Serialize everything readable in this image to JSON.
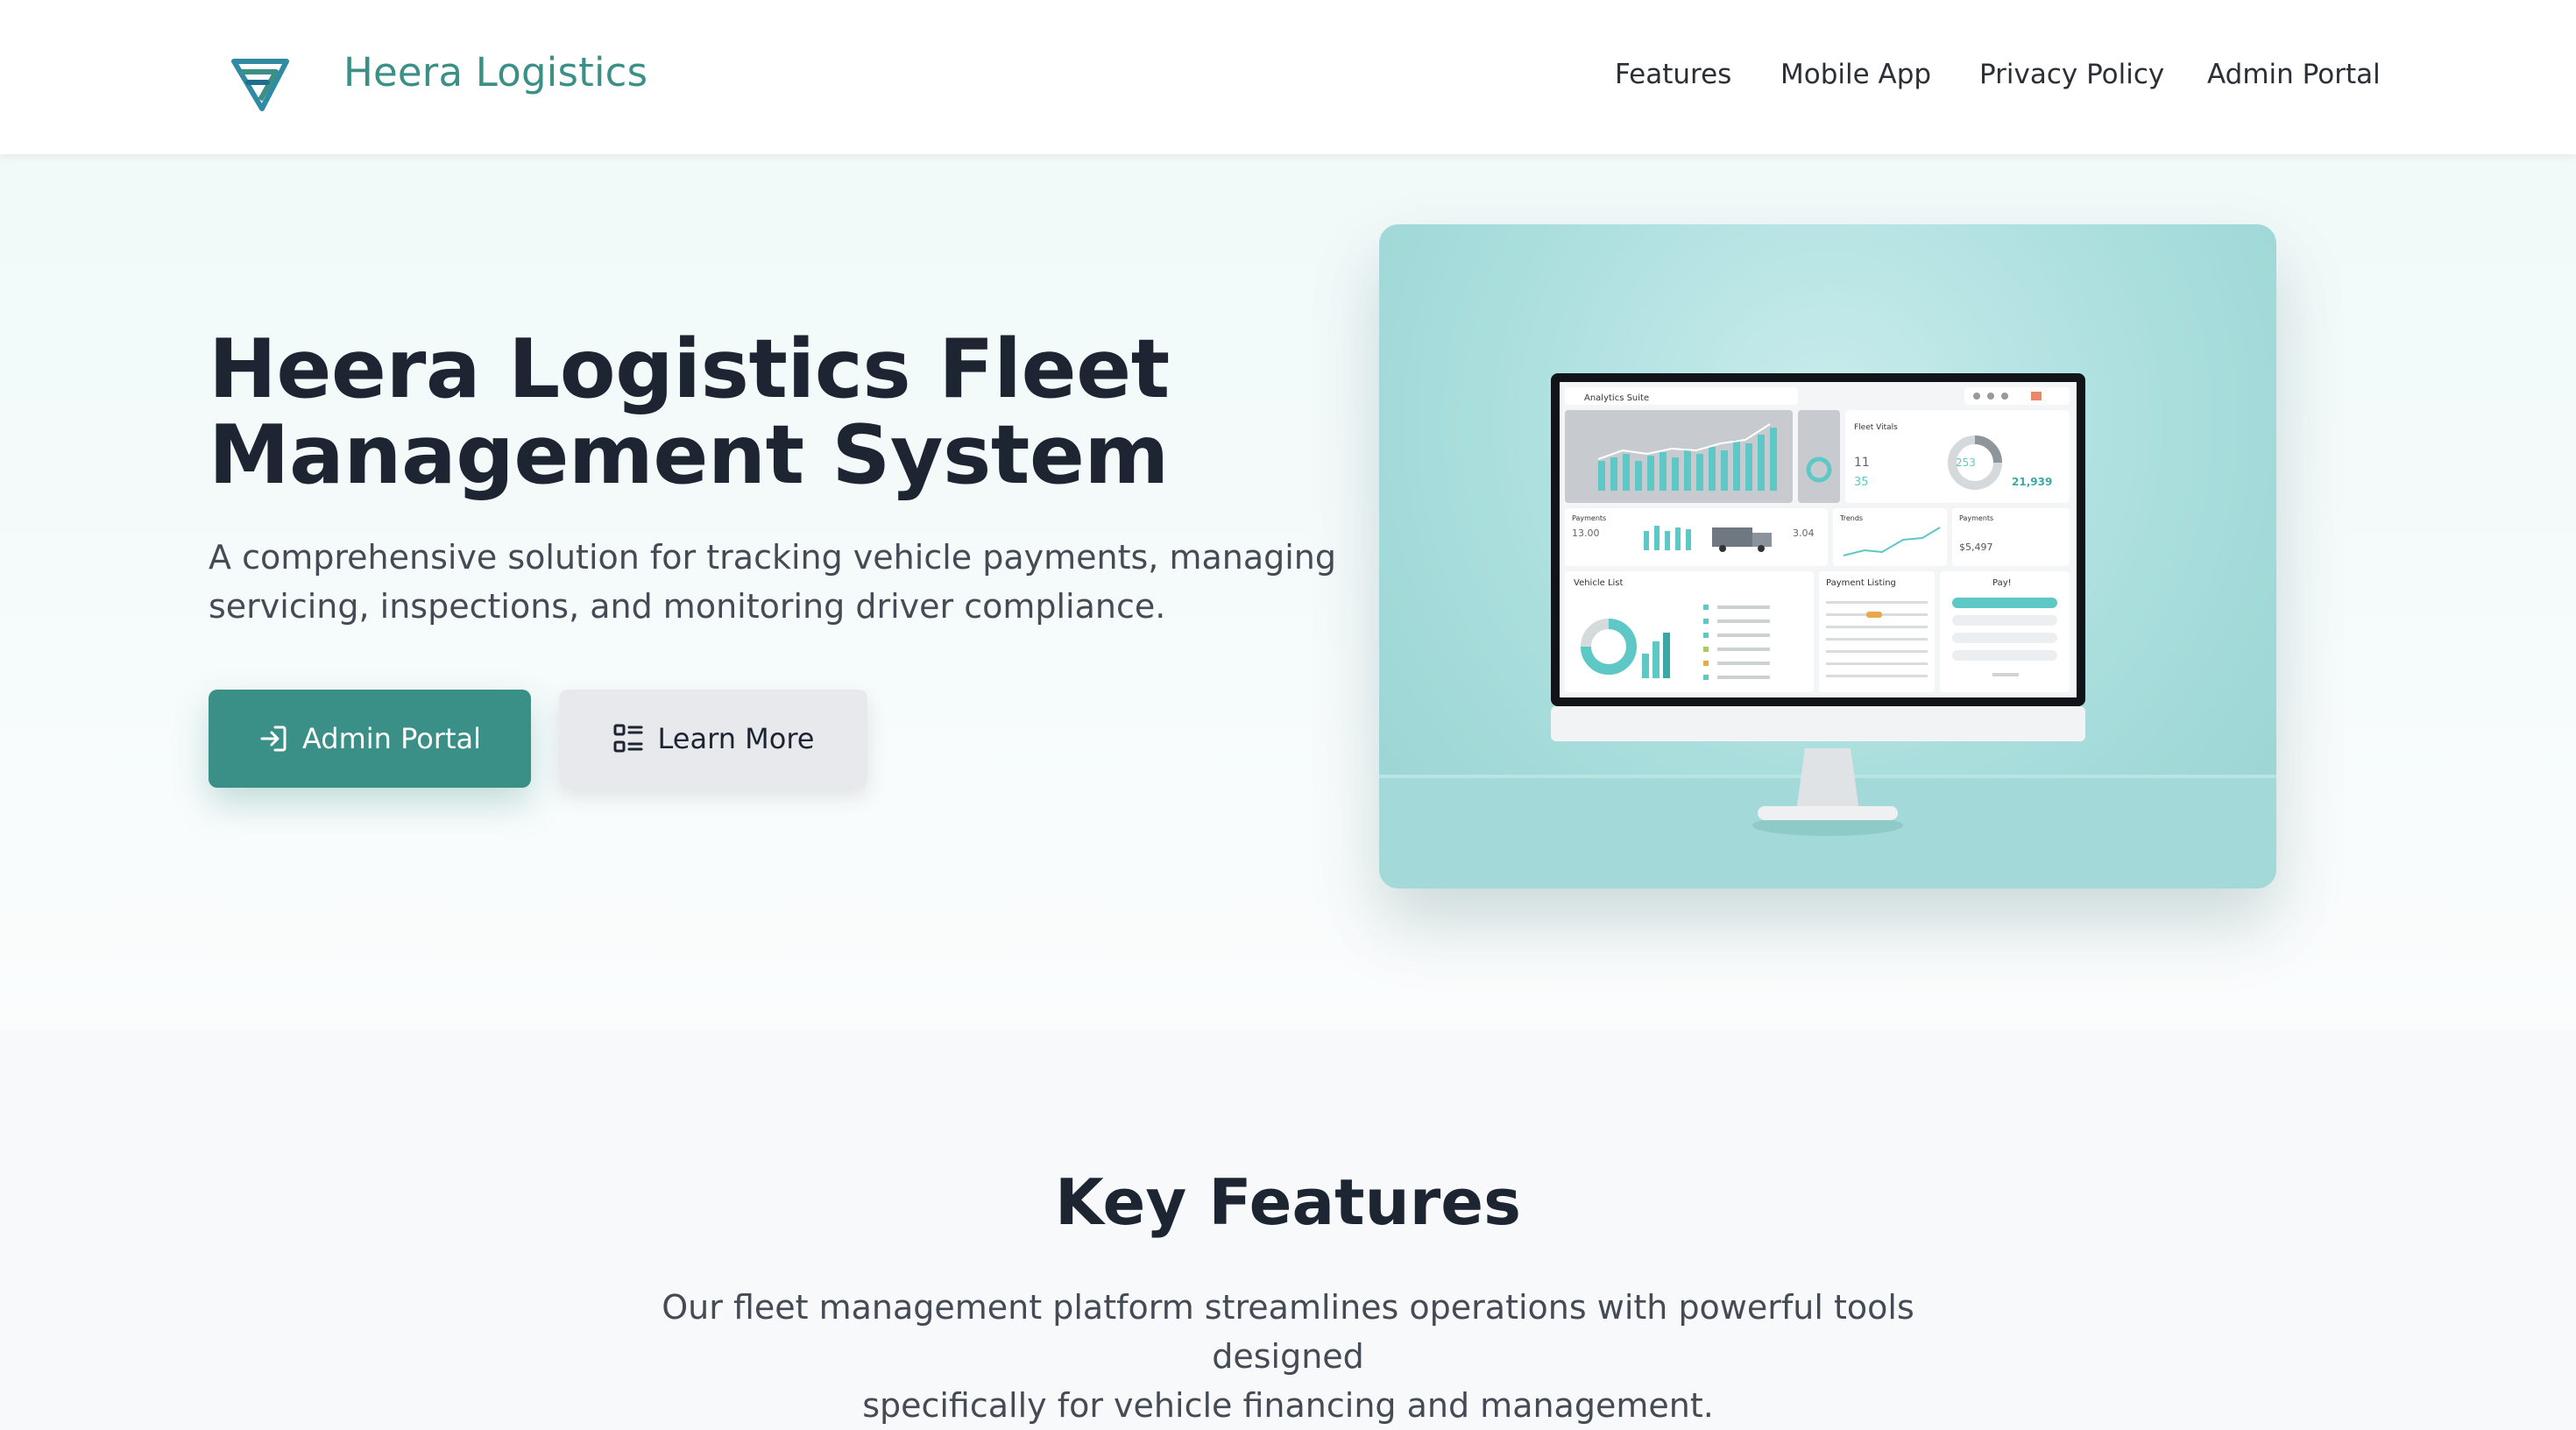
{
  "header": {
    "brand": "Heera Logistics",
    "logo_icon": "chevron-diamond-logo-icon",
    "nav": [
      {
        "label": "Features"
      },
      {
        "label": "Mobile App"
      },
      {
        "label": "Privacy Policy"
      },
      {
        "label": "Admin Portal"
      }
    ]
  },
  "hero": {
    "title_line1": "Heera Logistics Fleet",
    "title_line2": "Management System",
    "subtitle": "A comprehensive solution for tracking vehicle payments, managing servicing, inspections, and monitoring driver compliance.",
    "primary_button": {
      "label": "Admin Portal",
      "icon": "login-icon"
    },
    "secondary_button": {
      "label": "Learn More",
      "icon": "list-icon"
    },
    "image": {
      "description_icon": "dashboard-monitor-illustration",
      "screen_labels": {
        "topbar": "Analytics Suite",
        "card_a": "Fleet Vitals",
        "card_a_v1": "11",
        "card_a_v2": "35",
        "card_a_v3": "21,939",
        "card_a_gauge": "253",
        "row2_a": "Payments",
        "row2_a_v1": "13.00",
        "row2_a_v2": "3.04",
        "row2_b": "Trends",
        "row2_c": "Payments",
        "row2_c_v1": "$5,497",
        "vehicle_list": "Vehicle List",
        "payment_title": "Payment Listing",
        "pay_title": "Pay!"
      }
    }
  },
  "features": {
    "title": "Key Features",
    "subtitle_line1": "Our fleet management platform streamlines operations with powerful tools designed",
    "subtitle_line2": "specifically for vehicle financing and management."
  },
  "colors": {
    "brand": "#3a8f86",
    "text_dark": "#1e2532",
    "text_muted": "#454b55",
    "hero_image_bg": "#a9dedd",
    "secondary_button_bg": "#e7e9ec"
  }
}
